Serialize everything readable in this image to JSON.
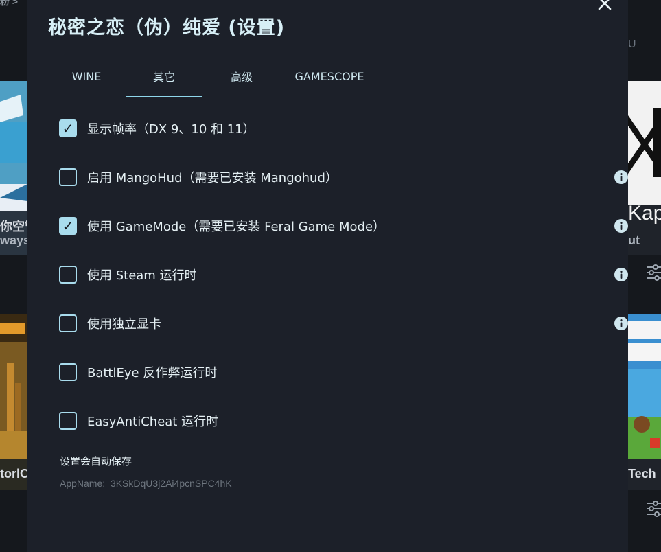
{
  "dialog": {
    "title": "秘密之恋（伪）纯爱 (设置)"
  },
  "tabs": [
    {
      "label": "WINE",
      "active": false
    },
    {
      "label": "其它",
      "active": true
    },
    {
      "label": "高级",
      "active": false
    },
    {
      "label": "GAMESCOPE",
      "active": false
    }
  ],
  "options": [
    {
      "label": "显示帧率（DX 9、10 和 11）",
      "checked": true,
      "info": false
    },
    {
      "label": "启用 MangoHud（需要已安装 Mangohud）",
      "checked": false,
      "info": true
    },
    {
      "label": "使用 GameMode（需要已安装 Feral Game Mode）",
      "checked": true,
      "info": true
    },
    {
      "label": "使用 Steam 运行时",
      "checked": false,
      "info": true
    },
    {
      "label": "使用独立显卡",
      "checked": false,
      "info": true
    },
    {
      "label": "BattlEye 反作弊运行时",
      "checked": false,
      "info": false
    },
    {
      "label": "EasyAntiCheat 运行时",
      "checked": false,
      "info": false
    }
  ],
  "footer": {
    "autosave_note": "设置会自动保存",
    "app_name_label": "AppName:",
    "app_name_value": "3KSkDqU3j2Ai4pcnSPC4hK"
  },
  "background": {
    "left_top_text1": "你空管",
    "left_top_text2": "ways",
    "left_bottom_text": "torlC",
    "right_top_text1": "Kap",
    "right_top_text2": "ut",
    "right_bottom_text": "Tech",
    "right_header_text": "U",
    "top_left_text": "粉 >"
  },
  "colors": {
    "accent": "#a9dced",
    "dialog_bg": "#1c2029",
    "page_bg": "#15181d"
  }
}
